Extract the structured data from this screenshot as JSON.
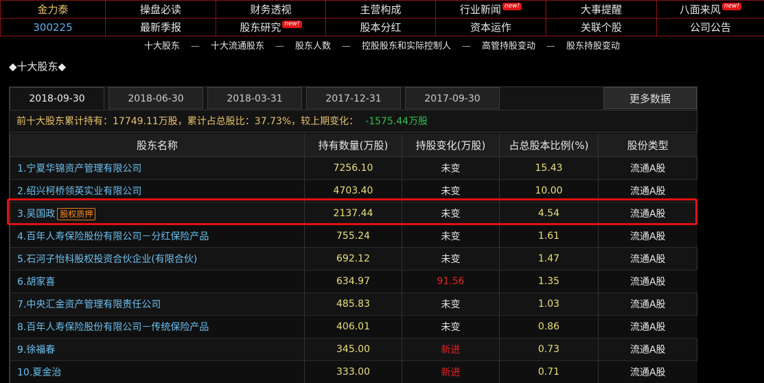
{
  "nav": {
    "stock_name": "金力泰",
    "stock_code": "300225",
    "row1": [
      {
        "label": "操盘必读",
        "new": false
      },
      {
        "label": "财务透视",
        "new": false
      },
      {
        "label": "主营构成",
        "new": false
      },
      {
        "label": "行业新闻",
        "new": true
      },
      {
        "label": "大事提醒",
        "new": false
      },
      {
        "label": "八面来风",
        "new": true
      }
    ],
    "row2": [
      {
        "label": "最新季报",
        "new": false
      },
      {
        "label": "股东研究",
        "new": true
      },
      {
        "label": "股本分红",
        "new": false
      },
      {
        "label": "资本运作",
        "new": false
      },
      {
        "label": "关联个股",
        "new": false
      },
      {
        "label": "公司公告",
        "new": false
      }
    ],
    "new_badge": "new!"
  },
  "subnav": {
    "items": [
      "十大股东",
      "十大流通股东",
      "股东人数",
      "控股股东和实际控制人",
      "高管持股变动",
      "股东持股变动"
    ],
    "separator": "—"
  },
  "section_title": "◆十大股东◆",
  "tabs": [
    "2018-09-30",
    "2018-06-30",
    "2018-03-31",
    "2017-12-31",
    "2017-09-30"
  ],
  "active_tab": 0,
  "more_data": "更多数据",
  "summary": {
    "text": "前十大股东累计持有：17749.11万股，累计占总股比：37.73%，较上期变化：",
    "change": "-1575.44万股"
  },
  "table": {
    "headers": [
      "股东名称",
      "持有数量(万股)",
      "持股变化(万股)",
      "占总股本比例(%)",
      "股份类型"
    ],
    "rows": [
      {
        "name": "1.宁夏华锦资产管理有限公司",
        "qty": "7256.10",
        "change": "未变",
        "change_red": false,
        "pct": "15.43",
        "type": "流通A股"
      },
      {
        "name": "2.绍兴柯桥领英实业有限公司",
        "qty": "4703.40",
        "change": "未变",
        "change_red": false,
        "pct": "10.00",
        "type": "流通A股"
      },
      {
        "name": "3.吴国政",
        "tag": "股权质押",
        "qty": "2137.44",
        "change": "未变",
        "change_red": false,
        "pct": "4.54",
        "type": "流通A股"
      },
      {
        "name": "4.百年人寿保险股份有限公司－分红保险产品",
        "qty": "755.24",
        "change": "未变",
        "change_red": false,
        "pct": "1.61",
        "type": "流通A股"
      },
      {
        "name": "5.石河子怡科股权投资合伙企业(有限合伙)",
        "qty": "692.12",
        "change": "未变",
        "change_red": false,
        "pct": "1.47",
        "type": "流通A股"
      },
      {
        "name": "6.胡家喜",
        "qty": "634.97",
        "change": "91.56",
        "change_red": true,
        "pct": "1.35",
        "type": "流通A股"
      },
      {
        "name": "7.中央汇金资产管理有限责任公司",
        "qty": "485.83",
        "change": "未变",
        "change_red": false,
        "pct": "1.03",
        "type": "流通A股"
      },
      {
        "name": "8.百年人寿保险股份有限公司－传统保险产品",
        "qty": "406.01",
        "change": "未变",
        "change_red": false,
        "pct": "0.86",
        "type": "流通A股"
      },
      {
        "name": "9.徐福春",
        "qty": "345.00",
        "change": "新进",
        "change_red": true,
        "pct": "0.73",
        "type": "流通A股"
      },
      {
        "name": "10.夏金治",
        "qty": "333.00",
        "change": "新进",
        "change_red": true,
        "pct": "0.71",
        "type": "流通A股"
      }
    ]
  }
}
